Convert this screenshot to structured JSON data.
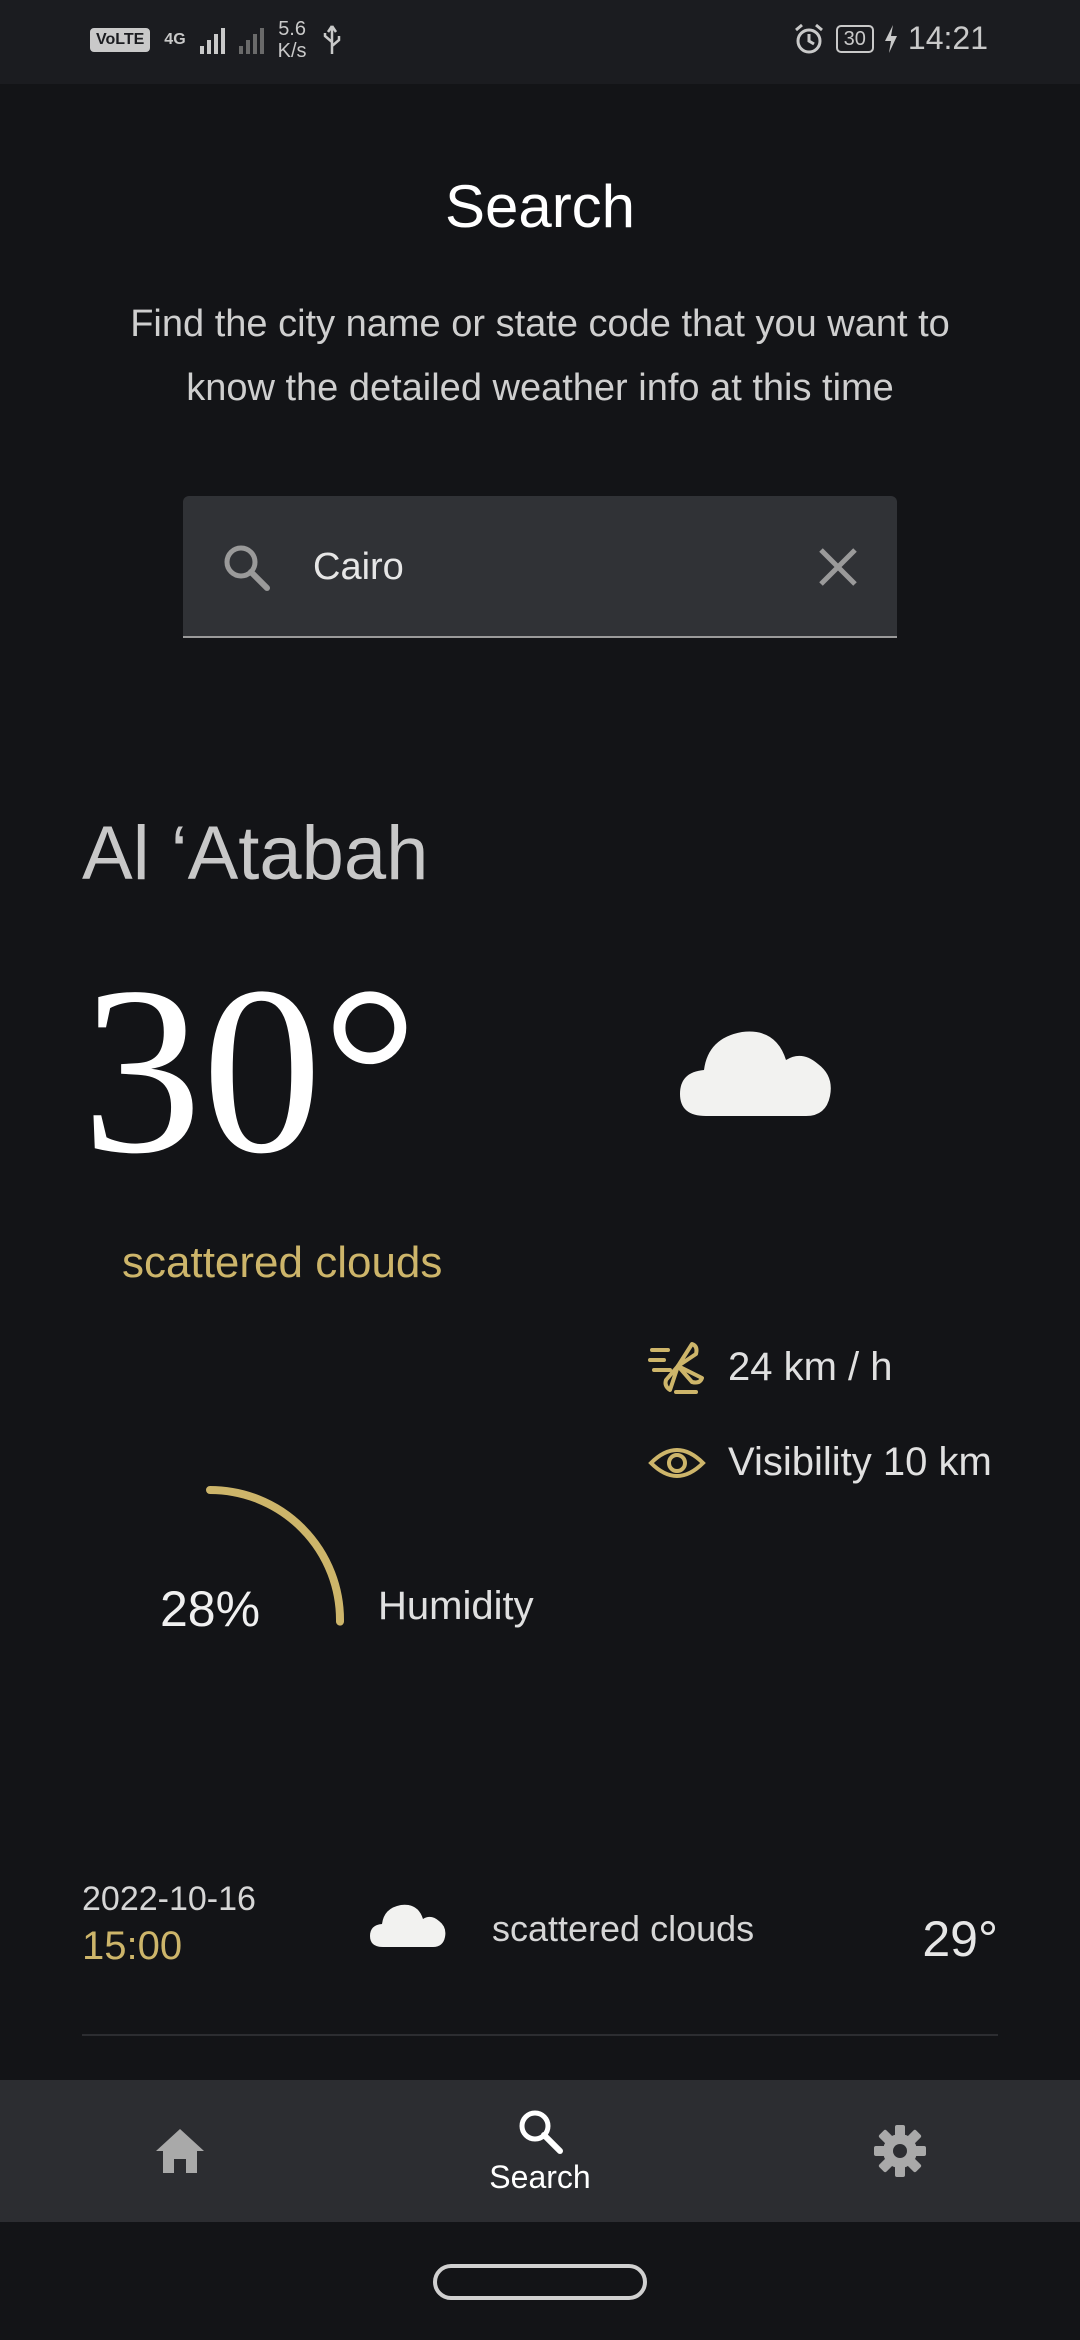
{
  "status_bar": {
    "volte": "VoLTE",
    "network": "4G",
    "speed_value": "5.6",
    "speed_unit": "K/s",
    "battery": "30",
    "time": "14:21",
    "icons": [
      "signal-icon",
      "usb-icon",
      "alarm-icon",
      "battery-icon",
      "charging-icon"
    ]
  },
  "header": {
    "title": "Search",
    "subtitle": "Find the city name or state code that you want to know the detailed weather info at this time"
  },
  "search": {
    "value": "Cairo",
    "placeholder": ""
  },
  "weather": {
    "city": "Al ‘Atabah",
    "temperature": "30°",
    "description": "scattered clouds",
    "wind": "24 km / h",
    "visibility": "Visibility 10 km",
    "humidity_value": "28%",
    "humidity_fraction": 0.28,
    "humidity_label": "Humidity"
  },
  "forecast": [
    {
      "date": "2022-10-16",
      "time": "15:00",
      "description": "scattered clouds",
      "temperature": "29°"
    }
  ],
  "nav": {
    "search_label": "Search"
  },
  "colors": {
    "background": "#131417",
    "accent": "#cdb56a",
    "surface": "#303236",
    "nav_bar": "#2c2d31"
  }
}
